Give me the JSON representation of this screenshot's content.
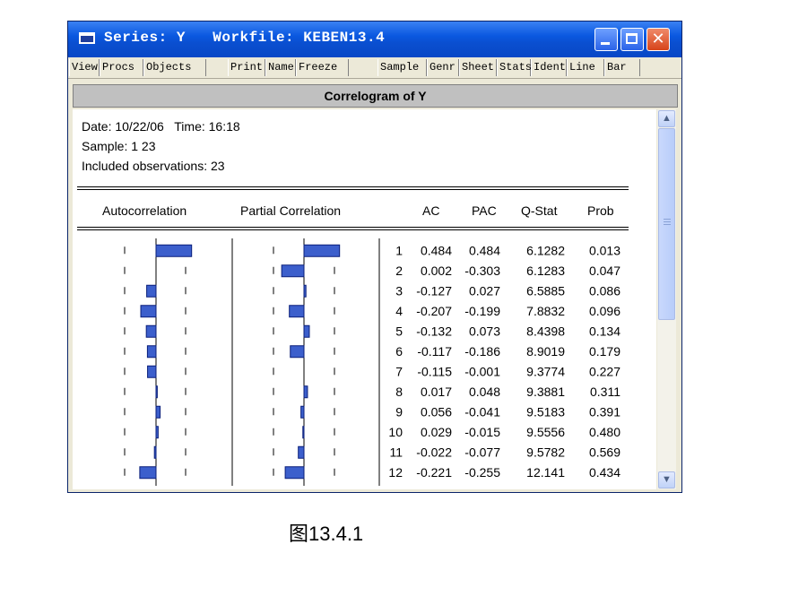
{
  "window": {
    "title_series": "Series: Y",
    "title_workfile": "Workfile: KEBEN13.4",
    "minimize_label": "",
    "close_label": "✕"
  },
  "toolbar": {
    "buttons": [
      "View",
      "Procs",
      "Objects",
      "Print",
      "Name",
      "Freeze",
      "Sample",
      "Genr",
      "Sheet",
      "Stats",
      "Ident",
      "Line",
      "Bar"
    ]
  },
  "view": {
    "header": "Correlogram of Y",
    "date_line": "Date: 10/22/06   Time: 16:18",
    "sample_line": "Sample: 1 23",
    "obs_line": "Included observations: 23",
    "columns": {
      "autocorrelation": "Autocorrelation",
      "partial_correlation": "Partial Correlation",
      "ac": "AC",
      "pac": "PAC",
      "qstat": "Q-Stat",
      "prob": "Prob"
    }
  },
  "chart_data": {
    "type": "table",
    "columns": [
      "",
      "AC",
      "PAC",
      "Q-Stat",
      "Prob"
    ],
    "rows": [
      {
        "lag": "1",
        "ac": "0.484",
        "pac": "0.484",
        "q": "6.1282",
        "prob": "0.013"
      },
      {
        "lag": "2",
        "ac": "0.002",
        "pac": "-0.303",
        "q": "6.1283",
        "prob": "0.047"
      },
      {
        "lag": "3",
        "ac": "-0.127",
        "pac": "0.027",
        "q": "6.5885",
        "prob": "0.086"
      },
      {
        "lag": "4",
        "ac": "-0.207",
        "pac": "-0.199",
        "q": "7.8832",
        "prob": "0.096"
      },
      {
        "lag": "5",
        "ac": "-0.132",
        "pac": "0.073",
        "q": "8.4398",
        "prob": "0.134"
      },
      {
        "lag": "6",
        "ac": "-0.117",
        "pac": "-0.186",
        "q": "8.9019",
        "prob": "0.179"
      },
      {
        "lag": "7",
        "ac": "-0.115",
        "pac": "-0.001",
        "q": "9.3774",
        "prob": "0.227"
      },
      {
        "lag": "8",
        "ac": "0.017",
        "pac": "0.048",
        "q": "9.3881",
        "prob": "0.311"
      },
      {
        "lag": "9",
        "ac": "0.056",
        "pac": "-0.041",
        "q": "9.5183",
        "prob": "0.391"
      },
      {
        "lag": "10",
        "ac": "0.029",
        "pac": "-0.015",
        "q": "9.5556",
        "prob": "0.480"
      },
      {
        "lag": "11",
        "ac": "-0.022",
        "pac": "-0.077",
        "q": "9.5782",
        "prob": "0.569"
      },
      {
        "lag": "12",
        "ac": "-0.221",
        "pac": "-0.255",
        "q": "12.141",
        "prob": "0.434"
      }
    ],
    "bar_color": "#3c5fcc",
    "bar_edge_color": "#0a1f7a"
  },
  "caption": "图13.4.1",
  "icons": {
    "window_icon": "eviews-window-icon",
    "scroll_up": "scroll-up-arrow-icon",
    "scroll_down": "scroll-down-arrow-icon"
  }
}
